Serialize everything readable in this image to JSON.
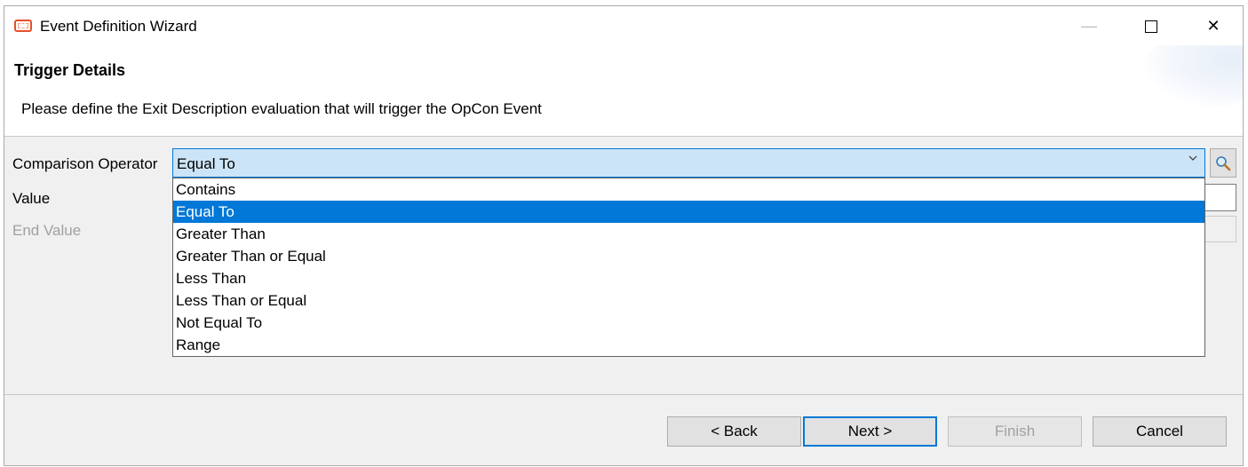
{
  "window": {
    "title": "Event Definition Wizard",
    "minimize_glyph": "—",
    "close_glyph": "✕"
  },
  "header": {
    "title": "Trigger Details",
    "description": "Please define the Exit Description evaluation that will trigger the OpCon Event"
  },
  "form": {
    "comparison_operator_label": "Comparison Operator",
    "comparison_operator_value": "Equal To",
    "value_label": "Value",
    "value_value": "",
    "end_value_label": "End Value",
    "end_value_value": "",
    "lookup_icon": "magnifier-icon",
    "options": [
      "Contains",
      "Equal To",
      "Greater Than",
      "Greater Than or Equal",
      "Less Than",
      "Less Than or Equal",
      "Not Equal To",
      "Range"
    ],
    "selected_option": "Equal To"
  },
  "buttons": {
    "back": "< Back",
    "next": "Next >",
    "finish": "Finish",
    "cancel": "Cancel"
  },
  "colors": {
    "accent": "#0078d7",
    "combo_background": "#cce4f7",
    "app_icon": "#e8502a"
  }
}
